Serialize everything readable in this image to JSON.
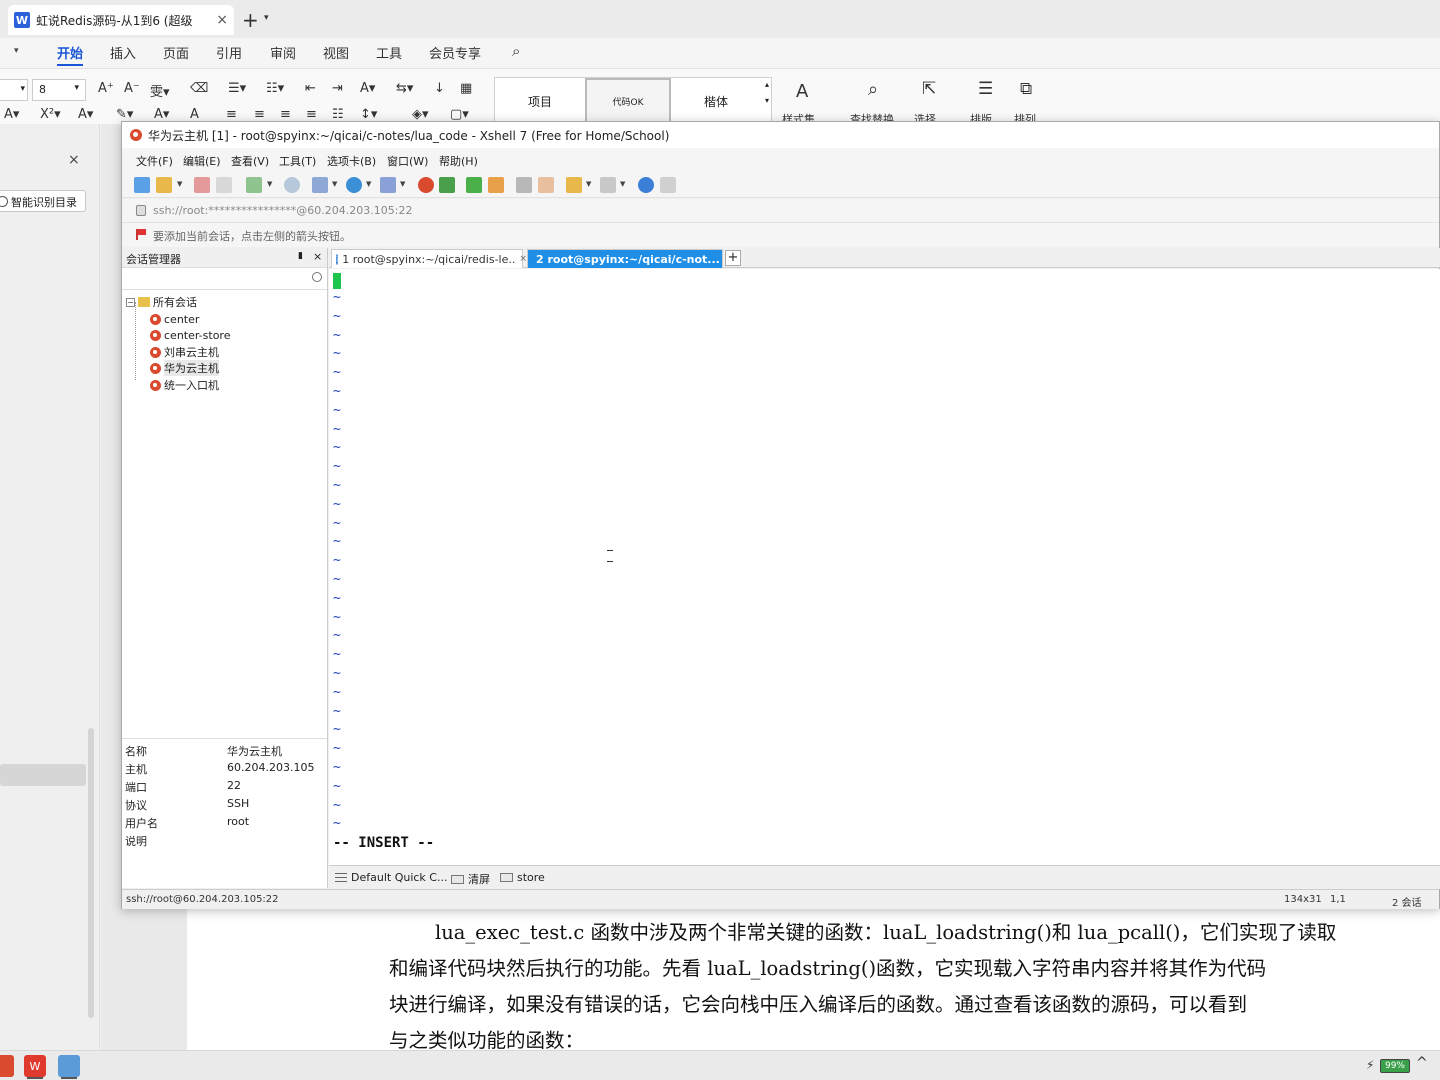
{
  "wps": {
    "tab_title": "虹说Redis源码-从1到6 (超级",
    "tab_close": "×",
    "new_tab": "+",
    "new_tab_dropdown": "▾",
    "menu_dropdown": "▾",
    "menu": [
      "开始",
      "插入",
      "页面",
      "引用",
      "审阅",
      "视图",
      "工具",
      "会员专享"
    ],
    "active_menu": "开始",
    "font_size": "8",
    "style_gallery": [
      "项目",
      "代码OK",
      "楷体"
    ],
    "ribbon_labels": [
      "样式集",
      "查找替换",
      "选择",
      "排版",
      "排列"
    ],
    "left_pane_close": "×",
    "smart_button": "智能识别目录",
    "document_paragraph": [
      "lua_exec_test.c 函数中涉及两个非常关键的函数：luaL_loadstring()和 lua_pcall()，它们实现了读取",
      "和编译代码块然后执行的功能。先看 luaL_loadstring()函数，它实现载入字符串内容并将其作为代码",
      "块进行编译，如果没有错误的话，它会向栈中压入编译后的函数。通过查看该函数的源码，可以看到",
      "与之类似功能的函数："
    ]
  },
  "xshell": {
    "title": "华为云主机 [1] - root@spyinx:~/qicai/c-notes/lua_code - Xshell 7 (Free for Home/School)",
    "menu": [
      "文件(F)",
      "编辑(E)",
      "查看(V)",
      "工具(T)",
      "选项卡(B)",
      "窗口(W)",
      "帮助(H)"
    ],
    "address": "ssh://root:****************@60.204.203.105:22",
    "hint": "要添加当前会话，点击左侧的箭头按钮。",
    "session_manager": {
      "title": "会话管理器",
      "pin": "▮",
      "close": "×",
      "root": "所有会话",
      "root_toggle": "−",
      "sessions": [
        "center",
        "center-store",
        "刘串云主机",
        "华为云主机",
        "统一入口机"
      ],
      "selected": "华为云主机",
      "properties": [
        {
          "key": "名称",
          "value": "华为云主机"
        },
        {
          "key": "主机",
          "value": "60.204.203.105"
        },
        {
          "key": "端口",
          "value": "22"
        },
        {
          "key": "协议",
          "value": "SSH"
        },
        {
          "key": "用户名",
          "value": "root"
        },
        {
          "key": "说明",
          "value": ""
        }
      ]
    },
    "tabs": [
      {
        "label": "1 root@spyinx:~/qicai/redis-le..",
        "active": false,
        "info": "i",
        "close": "×"
      },
      {
        "label": "2 root@spyinx:~/qicai/c-not...",
        "active": true,
        "close": "×"
      }
    ],
    "tab_add": "+",
    "terminal": {
      "tilde": "~",
      "tilde_count": 29,
      "mode_line": "-- INSERT --"
    },
    "quick_commands": [
      "Default Quick C...",
      "清屏",
      "store"
    ],
    "status": {
      "connection": "ssh://root@60.204.203.105:22",
      "size": "134x31",
      "position": "1,1",
      "sessions": "2 会话"
    }
  },
  "taskbar": {
    "battery": "99%",
    "tray_arrow": "^"
  },
  "colors": {
    "wps_accent": "#1a56d6",
    "xshell_tab_active": "#1f8ee6",
    "cursor": "#1ec64e",
    "vim_tilde": "#2244bb"
  }
}
